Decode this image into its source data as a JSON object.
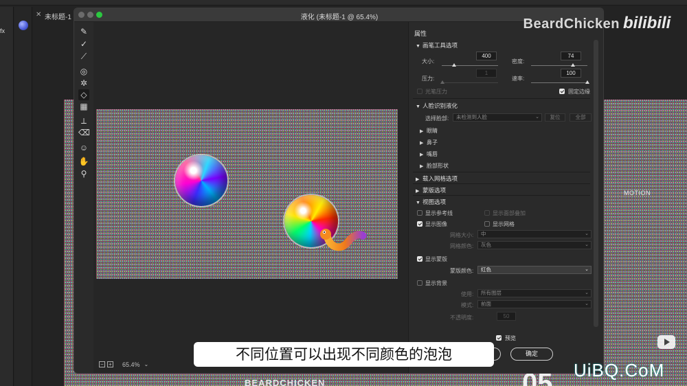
{
  "app": {
    "doc_tab": "未标题-1 @",
    "fx_label": "fx"
  },
  "background": {
    "side_text": "MOTION",
    "bottom_text": "BEARDCHICKEN",
    "big_num": "05"
  },
  "overlay": {
    "watermark": "BeardChicken",
    "bilibili": "bilibili",
    "corner_logo": "UiBQ.CoM",
    "subtitle": "不同位置可以出现不同颜色的泡泡"
  },
  "dialog": {
    "title": "液化 (未标题-1 @ 65.4%)",
    "zoom": "65.4%",
    "zoom_out": "−",
    "zoom_in": "+",
    "ok_label": "确定",
    "preview_label": "预览",
    "preview_checked": true
  },
  "tools": [
    "forward-warp",
    "reconstruct",
    "smooth",
    "twirl",
    "pucker",
    "bloat",
    "push-left",
    "freeze-mask",
    "thaw-mask",
    "face",
    "hand",
    "zoom"
  ],
  "props": {
    "header": "属性",
    "brush": {
      "title": "画笔工具选项",
      "size_label": "大小:",
      "size": "400",
      "density_label": "密度:",
      "density": "74",
      "pressure_label": "压力:",
      "pressure": "1",
      "rate_label": "速率:",
      "rate": "100",
      "stylus_label": "光笔压力",
      "pin_edges_label": "固定边缘",
      "pin_edges": true,
      "size_level": 0.22,
      "density_level": 0.74,
      "pressure_level": 0.01,
      "rate_level": 1.0
    },
    "face": {
      "title": "人脸识别液化",
      "select_label": "选择脸部:",
      "select_value": "未检测到人脸",
      "reset": "复位",
      "all": "全部",
      "items": [
        "眼睛",
        "鼻子",
        "嘴唇",
        "脸部形状"
      ]
    },
    "load_mesh": "载入网格选项",
    "mask": "蒙版选项",
    "view": {
      "title": "视图选项",
      "show_guides": "显示参考线",
      "show_face_overlay": "显示面部叠加",
      "show_image": "显示图像",
      "show_mesh": "显示网格",
      "mesh_size_label": "网格大小:",
      "mesh_size": "中",
      "mesh_color_label": "网格颜色:",
      "mesh_color": "灰色",
      "show_mask": "显示蒙版",
      "mask_color_label": "蒙版颜色:",
      "mask_color": "红色",
      "show_backdrop": "显示背景",
      "use_label": "使用:",
      "use_value": "所有图层",
      "mode_label": "模式:",
      "mode_value": "前面",
      "opacity_label": "不透明度:",
      "opacity": "50"
    }
  },
  "colors": {
    "dialog_bg": "#2a2a2a",
    "traffic_green": "#2bc840",
    "worm_orange": "#f07a1a",
    "worm_purple": "#9a3fd0"
  }
}
